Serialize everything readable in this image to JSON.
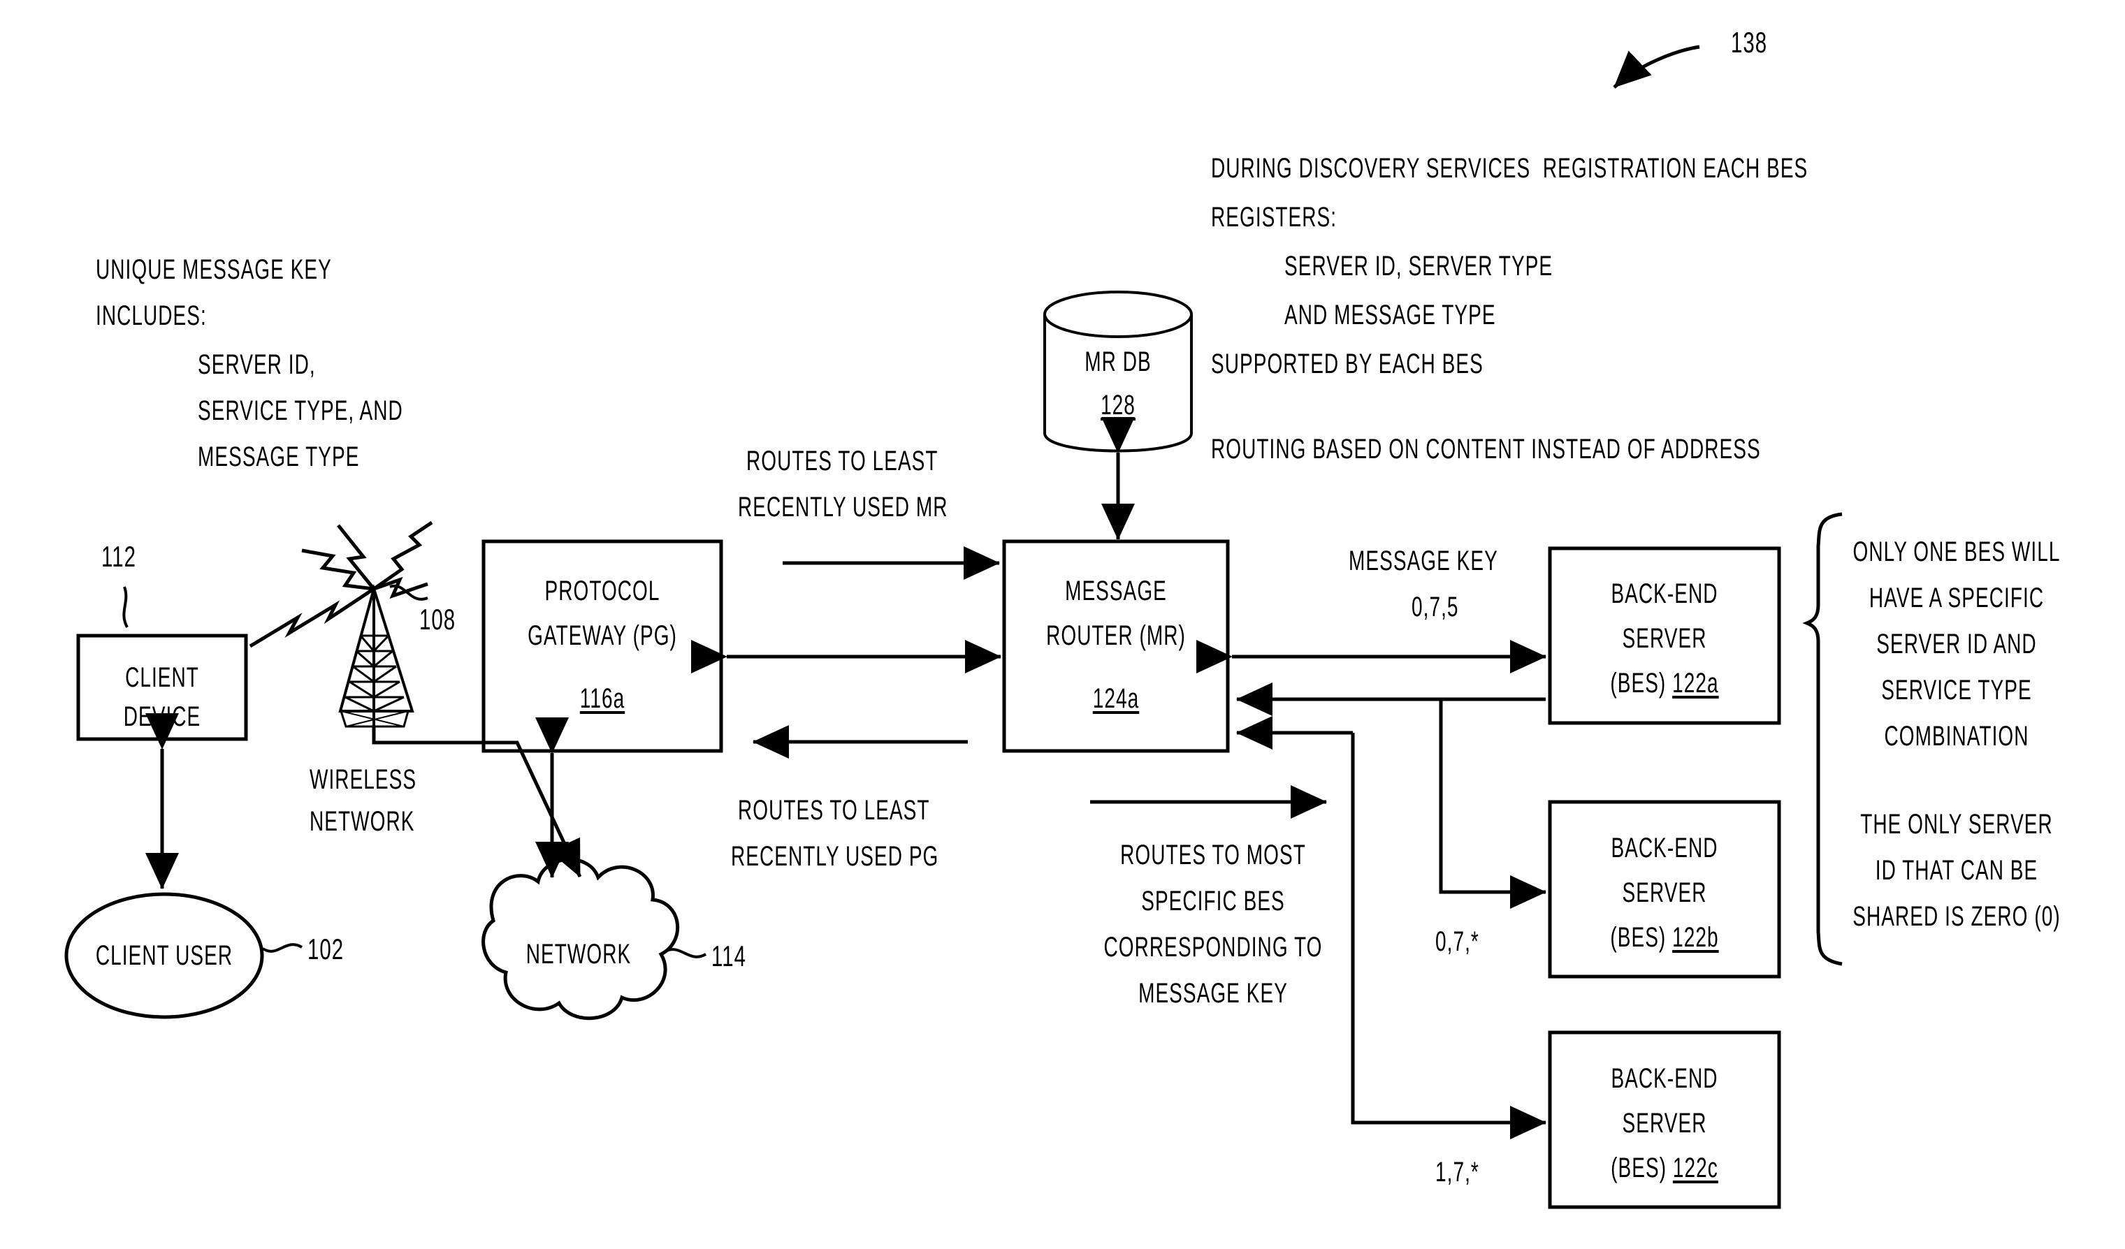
{
  "figure": {
    "callout_number": "138"
  },
  "notes": {
    "left_key": {
      "lines": [
        "UNIQUE MESSAGE KEY",
        "INCLUDES:"
      ],
      "indented": [
        "SERVER ID,",
        "SERVICE TYPE, AND",
        "MESSAGE TYPE"
      ]
    },
    "registration": {
      "lines": [
        "DURING DISCOVERY SERVICES  REGISTRATION EACH BES",
        "REGISTERS:"
      ],
      "indented": [
        "SERVER ID, SERVER TYPE",
        "AND MESSAGE TYPE"
      ],
      "tail": [
        "SUPPORTED BY EACH BES"
      ],
      "routing": "ROUTING BASED ON CONTENT INSTEAD OF ADDRESS"
    },
    "bes_constraint": {
      "paragraph1": [
        "ONLY ONE BES WILL",
        "HAVE A SPECIFIC",
        "SERVER ID AND",
        "SERVICE TYPE",
        "COMBINATION"
      ],
      "paragraph2": [
        "THE ONLY SERVER",
        "ID THAT CAN BE",
        "SHARED IS ZERO (0)"
      ]
    }
  },
  "nodes": {
    "client_device": {
      "lines": [
        "CLIENT",
        "DEVICE"
      ],
      "ref": "112"
    },
    "client_user": {
      "label": "CLIENT USER",
      "ref": "102"
    },
    "antenna": {
      "ref": "108",
      "caption": [
        "WIRELESS",
        "NETWORK"
      ]
    },
    "network_cloud": {
      "label": "NETWORK",
      "ref": "114"
    },
    "protocol_gateway": {
      "lines": [
        "PROTOCOL",
        "GATEWAY (PG)"
      ],
      "ref": "116a"
    },
    "message_router": {
      "lines": [
        "MESSAGE",
        "ROUTER (MR)"
      ],
      "ref": "124a"
    },
    "mr_db": {
      "label": "MR DB",
      "ref": "128"
    },
    "bes_a": {
      "lines": [
        "BACK-END",
        "SERVER"
      ],
      "suffix": "(BES) ",
      "ref": "122a"
    },
    "bes_b": {
      "lines": [
        "BACK-END",
        "SERVER"
      ],
      "suffix": "(BES) ",
      "ref": "122b"
    },
    "bes_c": {
      "lines": [
        "BACK-END",
        "SERVER"
      ],
      "suffix": "(BES) ",
      "ref": "122c"
    }
  },
  "edge_labels": {
    "pg_to_mr": [
      "ROUTES TO LEAST",
      "RECENTLY USED MR"
    ],
    "mr_to_pg": [
      "ROUTES TO LEAST",
      "RECENTLY USED PG"
    ],
    "mr_to_bes": [
      "ROUTES TO MOST",
      "SPECIFIC BES",
      "CORRESPONDING TO",
      "MESSAGE KEY"
    ],
    "message_key_title": "MESSAGE KEY",
    "key_a": "0,7,5",
    "key_b": "0,7,*",
    "key_c": "1,7,*"
  },
  "style": {
    "ink": "#000000",
    "paper": "#ffffff"
  }
}
